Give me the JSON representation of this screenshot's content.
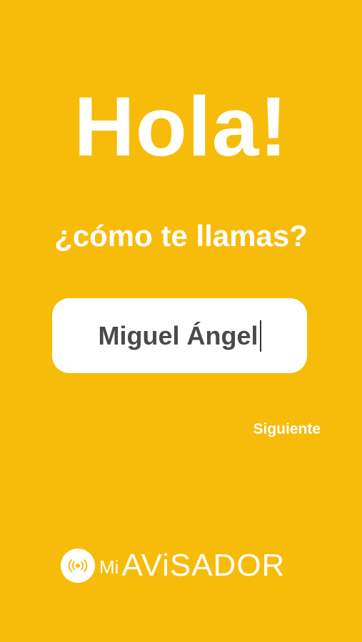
{
  "greeting": {
    "title": "Hola!",
    "question": "¿cómo te llamas?"
  },
  "form": {
    "name_value": "Miguel Ángel"
  },
  "actions": {
    "next_label": "Siguiente"
  },
  "brand": {
    "prefix": "Mi",
    "name": "AViSADOR",
    "icon": "broadcast-icon"
  },
  "colors": {
    "background": "#F7BC0A",
    "text_light": "#FFFFFF",
    "input_text": "#4A4A4A"
  }
}
